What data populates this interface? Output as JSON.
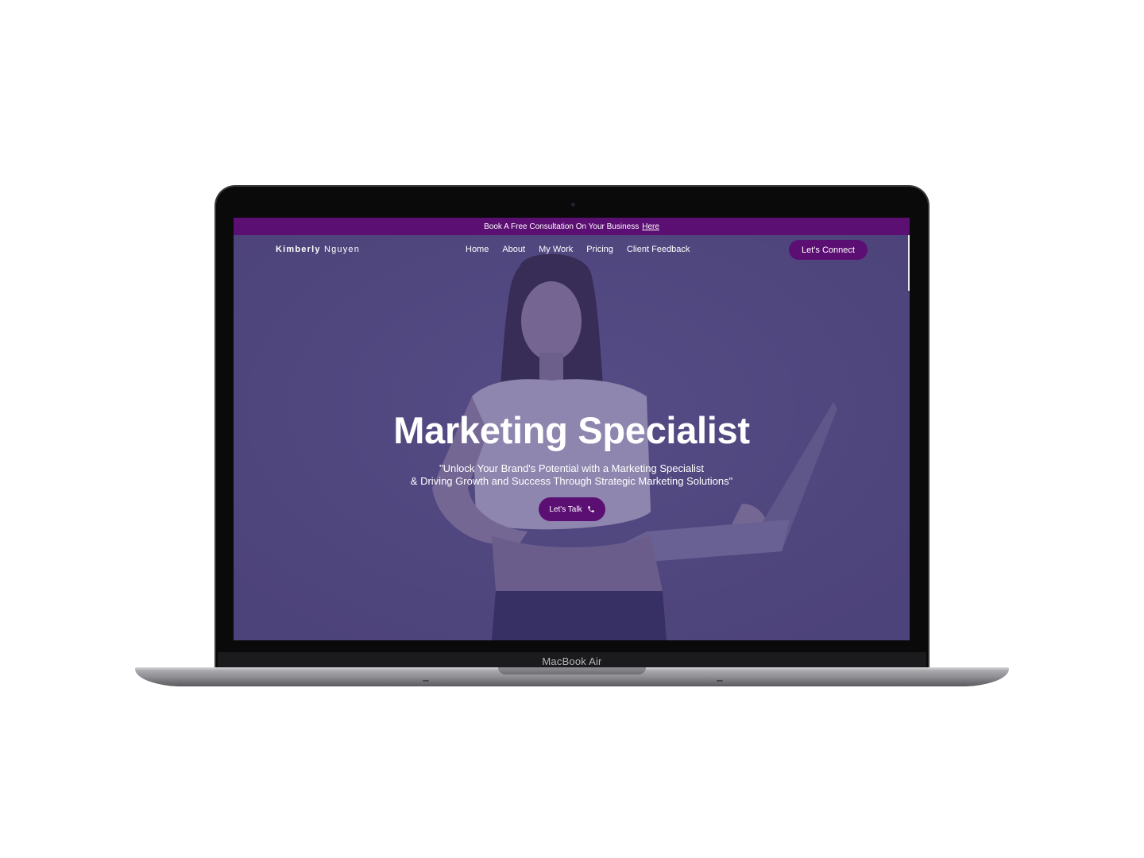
{
  "device": {
    "label": "MacBook Air"
  },
  "announcement": {
    "text": "Book A Free Consultation On Your Business",
    "link_label": "Here"
  },
  "nav": {
    "brand_first": "Kimberly",
    "brand_last": "Nguyen",
    "links": [
      "Home",
      "About",
      "My Work",
      "Pricing",
      "Client Feedback"
    ],
    "cta_label": "Let's Connect"
  },
  "hero": {
    "title": "Marketing Specialist",
    "subtitle_line1": "\"Unlock Your Brand's Potential with a Marketing Specialist",
    "subtitle_line2": "& Driving Growth and Success Through Strategic Marketing Solutions\"",
    "button_label": "Let's Talk",
    "button_icon": "phone-icon"
  },
  "colors": {
    "accent": "#5c0f73",
    "hero_overlay": "#554d7e",
    "text": "#ffffff"
  }
}
